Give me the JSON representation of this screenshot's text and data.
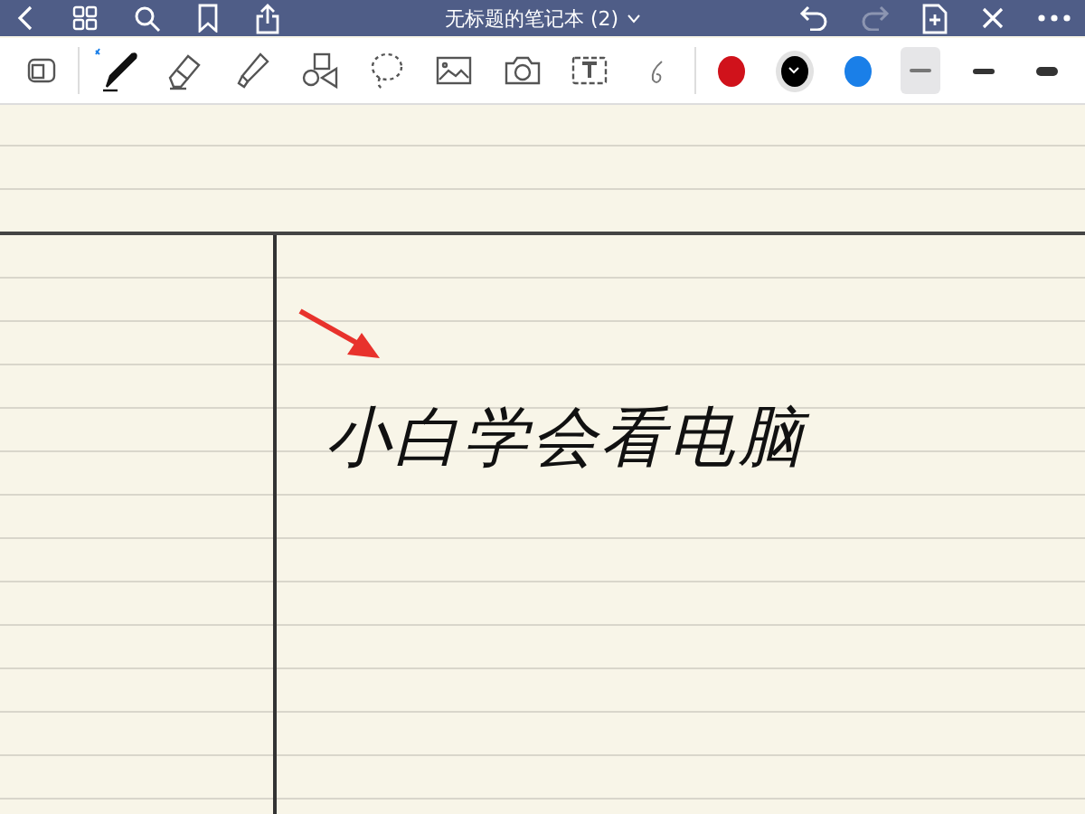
{
  "nav_bar": {
    "title": "无标题的笔记本 (2)",
    "undo_enabled": true,
    "redo_enabled": false
  },
  "toolbar": {
    "tools": [
      {
        "kind": "zoom-window",
        "selected": false
      },
      {
        "kind": "pen",
        "selected": true
      },
      {
        "kind": "eraser",
        "selected": false
      },
      {
        "kind": "highlighter",
        "selected": false
      },
      {
        "kind": "shapes",
        "selected": false
      },
      {
        "kind": "lasso",
        "selected": false
      },
      {
        "kind": "image",
        "selected": false
      },
      {
        "kind": "camera",
        "selected": false
      },
      {
        "kind": "text",
        "selected": false
      },
      {
        "kind": "pointer",
        "selected": false
      }
    ],
    "colors": [
      {
        "color": "#d0121b",
        "selected": false
      },
      {
        "color": "#000000",
        "selected": true
      },
      {
        "color": "#1a7fe8",
        "selected": false
      }
    ],
    "widths": [
      {
        "kind": "thin",
        "selected": true
      },
      {
        "kind": "medium",
        "selected": false
      },
      {
        "kind": "thick",
        "selected": false
      }
    ]
  },
  "page": {
    "handwriting": "小白学会看电脑"
  }
}
